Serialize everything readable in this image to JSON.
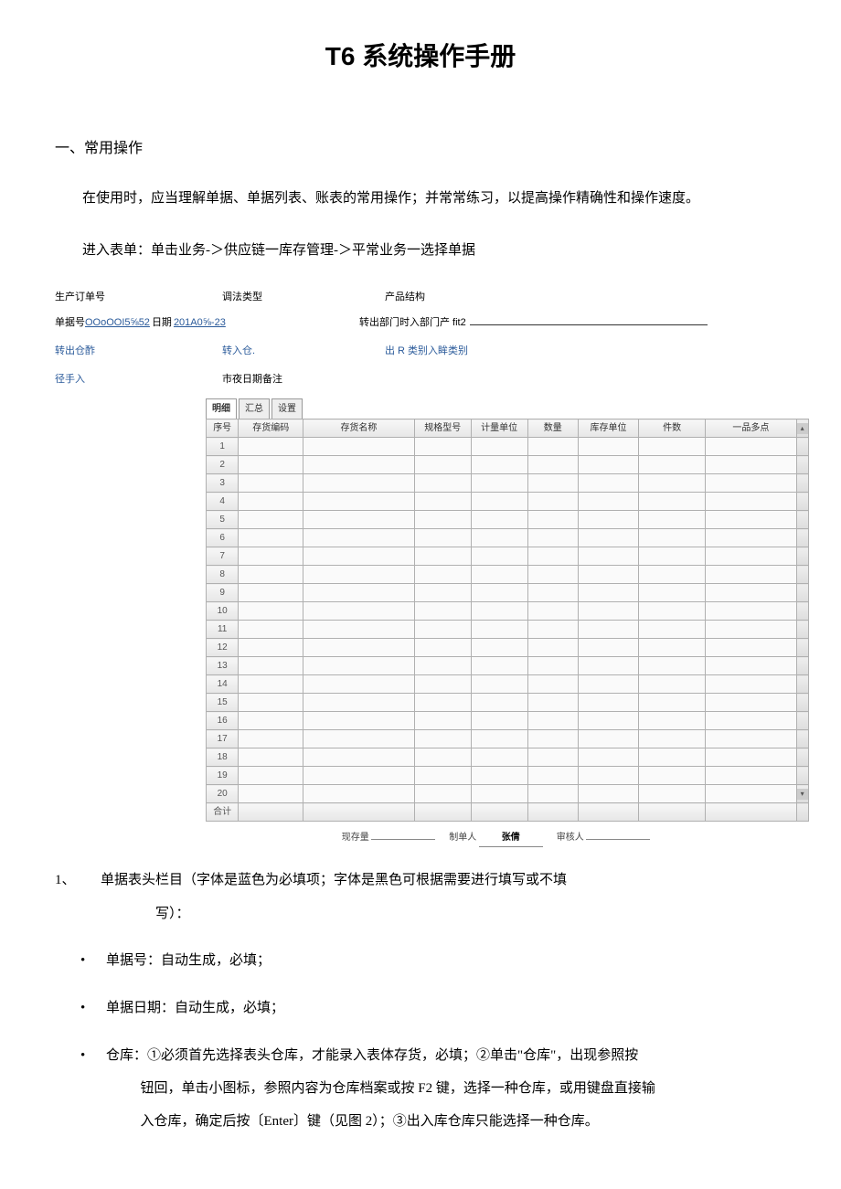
{
  "title": "T6 系统操作手册",
  "section1": {
    "heading": "一、常用操作",
    "para1": "在使用时，应当理解单据、单据列表、账表的常用操作；并常常练习，以提高操作精确性和操作速度。",
    "para2": "进入表单：单击业务-＞供应链一库存管理-＞平常业务一选择单据"
  },
  "form": {
    "row1": {
      "prod_order_label": "生产订单号",
      "adjust_type_label": "调法类型",
      "product_struct_label": "产品结构"
    },
    "row2": {
      "doc_no_label": "单据号",
      "doc_no_value": "OOoOOI5⅝52",
      "date_label": "日期",
      "date_value": "201A0⅝-23",
      "transfer_out_dept_label": "转出部门时入部门产 fit2"
    },
    "row3": {
      "out_wh_label": "转出仓酢",
      "in_wh_label": "转入仓.",
      "out_in_type_label": "出 R 类别入眸类别"
    },
    "row4": {
      "handler_label": "径手入",
      "date_memo_label": "市夜日期备注"
    }
  },
  "tabs": {
    "detail": "明细",
    "summary": "汇总",
    "settings": "设置"
  },
  "grid": {
    "cols": [
      "序号",
      "存货编码",
      "存货名称",
      "规格型号",
      "计量单位",
      "数量",
      "库存单位",
      "件数",
      "一品多点"
    ],
    "row_count": 20,
    "sum_label": "合计"
  },
  "footer": {
    "stock_qty": "现存量",
    "maker": "制单人",
    "maker_value": "张倩",
    "auditor": "审核人"
  },
  "notes": {
    "item1_num": "1、",
    "item1_line1": "单据表头栏目（字体是蓝色为必填项；字体是黑色可根据需要进行填写或不填",
    "item1_line2": "写）：",
    "b1": "单据号：自动生成，必填；",
    "b2": "单据日期：自动生成，必填；",
    "b3a": "仓库：①必须首先选择表头仓库，才能录入表体存货，必填；②单击\"仓库\"，出现参照按",
    "b3b": "钮回，单击小图标，参照内容为仓库档案或按 F2 键，选择一种仓库，或用键盘直接输",
    "b3c": "入仓库，确定后按〔Enter〕键（见图 2）；③出入库仓库只能选择一种仓库。",
    "bullet": "•"
  }
}
